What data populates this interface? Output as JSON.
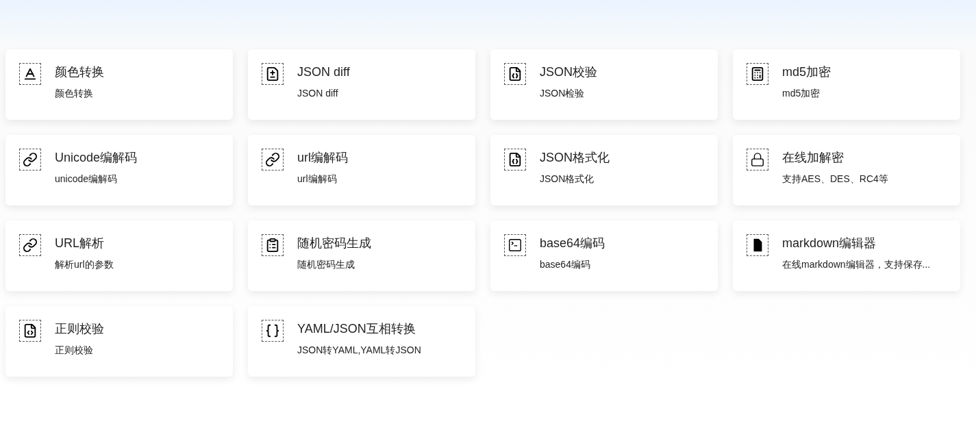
{
  "tools": [
    {
      "kind": "textcolor",
      "title": "颜色转换",
      "description": "颜色转换"
    },
    {
      "kind": "diff",
      "title": "JSON diff",
      "description": "JSON diff"
    },
    {
      "kind": "json",
      "title": "JSON校验",
      "description": "JSON检验"
    },
    {
      "kind": "calculator",
      "title": "md5加密",
      "description": "md5加密"
    },
    {
      "kind": "link",
      "title": "Unicode编解码",
      "description": "unicode编解码"
    },
    {
      "kind": "link",
      "title": "url编解码",
      "description": "url编解码"
    },
    {
      "kind": "json",
      "title": "JSON格式化",
      "description": "JSON格式化"
    },
    {
      "kind": "lock",
      "title": "在线加解密",
      "description": "支持AES、DES、RC4等"
    },
    {
      "kind": "link",
      "title": "URL解析",
      "description": "解析url的参数"
    },
    {
      "kind": "clipboard",
      "title": "随机密码生成",
      "description": "随机密码生成"
    },
    {
      "kind": "terminal",
      "title": "base64编码",
      "description": "base64编码"
    },
    {
      "kind": "markdown",
      "title": "markdown编辑器",
      "description": "在线markdown编辑器，支持保存..."
    },
    {
      "kind": "regex",
      "title": "正则校验",
      "description": "正则校验"
    },
    {
      "kind": "braces",
      "title": "YAML/JSON互相转换",
      "description": "JSON转YAML,YAML转JSON"
    }
  ]
}
